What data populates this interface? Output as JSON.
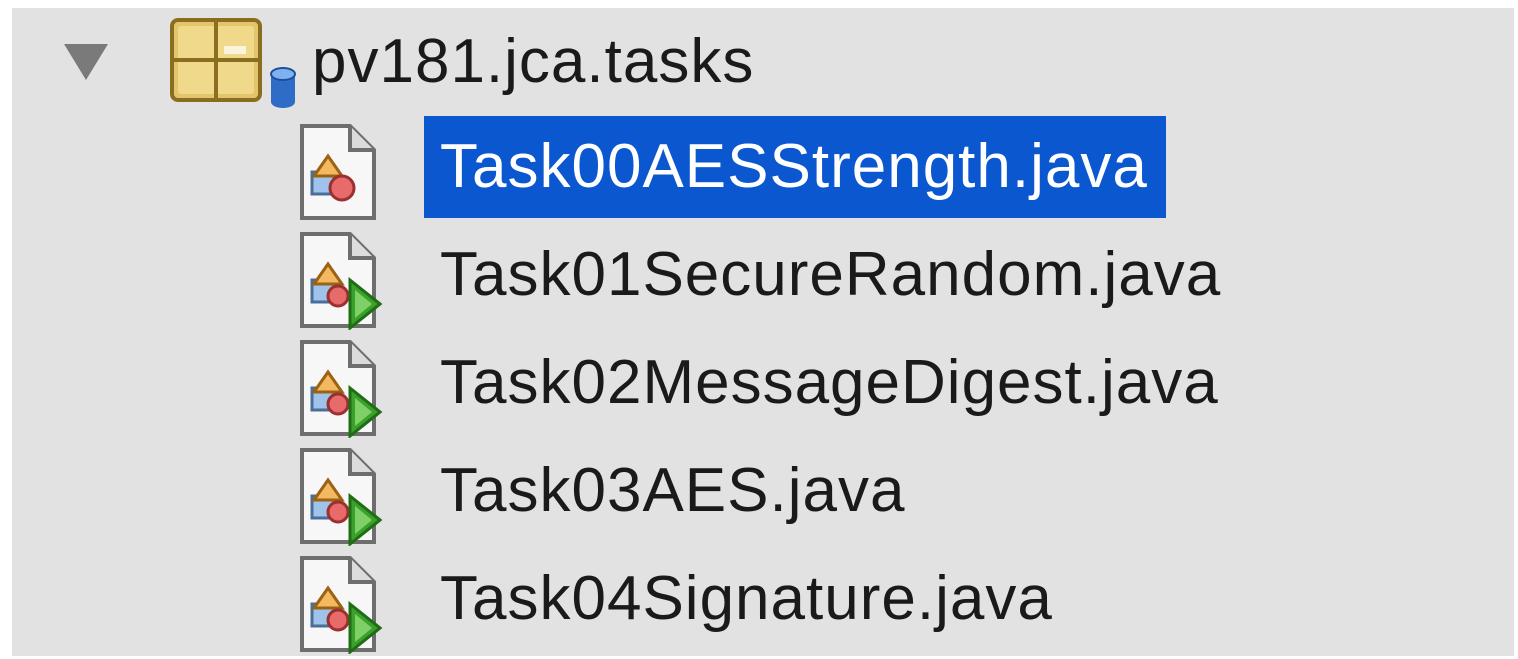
{
  "tree": {
    "package": {
      "label": "pv181.jca.tasks",
      "expanded": true,
      "icon": "package-icon"
    },
    "files": [
      {
        "label": "Task00AESStrength.java",
        "icon": "java-class-icon",
        "runnable": false,
        "selected": true
      },
      {
        "label": "Task01SecureRandom.java",
        "icon": "java-main-class-icon",
        "runnable": true,
        "selected": false
      },
      {
        "label": "Task02MessageDigest.java",
        "icon": "java-main-class-icon",
        "runnable": true,
        "selected": false
      },
      {
        "label": "Task03AES.java",
        "icon": "java-main-class-icon",
        "runnable": true,
        "selected": false
      },
      {
        "label": "Task04Signature.java",
        "icon": "java-main-class-icon",
        "runnable": true,
        "selected": false
      }
    ]
  },
  "colors": {
    "panel_background": "#e2e2e2",
    "selection_background": "#0b57d0",
    "selection_text": "#ffffff",
    "text": "#1a1a1a",
    "run_arrow": "#3aa12a"
  }
}
